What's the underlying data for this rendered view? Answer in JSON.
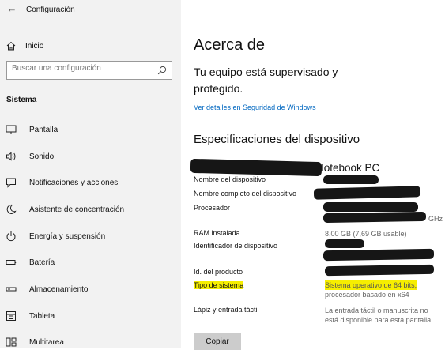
{
  "window": {
    "title": "Configuración",
    "back_glyph": "←"
  },
  "sidebar": {
    "home_label": "Inicio",
    "search_placeholder": "Buscar una configuración",
    "section": "Sistema",
    "items": [
      {
        "label": "Pantalla",
        "icon": "monitor-icon"
      },
      {
        "label": "Sonido",
        "icon": "speaker-icon"
      },
      {
        "label": "Notificaciones y acciones",
        "icon": "notification-icon"
      },
      {
        "label": "Asistente de concentración",
        "icon": "moon-icon"
      },
      {
        "label": "Energía y suspensión",
        "icon": "power-icon"
      },
      {
        "label": "Batería",
        "icon": "battery-icon"
      },
      {
        "label": "Almacenamiento",
        "icon": "storage-icon"
      },
      {
        "label": "Tableta",
        "icon": "tablet-icon"
      },
      {
        "label": "Multitarea",
        "icon": "multitask-icon"
      }
    ]
  },
  "main": {
    "title": "Acerca de",
    "supervised": "Tu equipo está supervisado y protegido.",
    "security_link": "Ver detalles en Seguridad de Windows",
    "specs_title": "Especificaciones del dispositivo",
    "device_name_visible": "Notebook PC",
    "rows": {
      "device_name_label": "Nombre del dispositivo",
      "full_name_label": "Nombre completo del dispositivo",
      "processor_label": "Procesador",
      "processor_value_visible": "GHz",
      "ram_label": "RAM instalada",
      "ram_value": "8,00 GB (7,69 GB usable)",
      "device_id_label": "Identificador de dispositivo",
      "product_id_label": "Id. del producto",
      "system_type_label": "Tipo de sistema",
      "system_type_value": "Sistema operativo de 64 bits,",
      "system_type_value2": "procesador basado en x64",
      "pen_label": "Lápiz y entrada táctil",
      "pen_value": "La entrada táctil o manuscrita no",
      "pen_value2": "está disponible para esta pantalla"
    },
    "copy_button": "Copiar"
  },
  "colors": {
    "sidebar_bg": "#f2f2f2",
    "link": "#0067c0",
    "highlight": "#f6ee00",
    "redaction": "#161616"
  }
}
